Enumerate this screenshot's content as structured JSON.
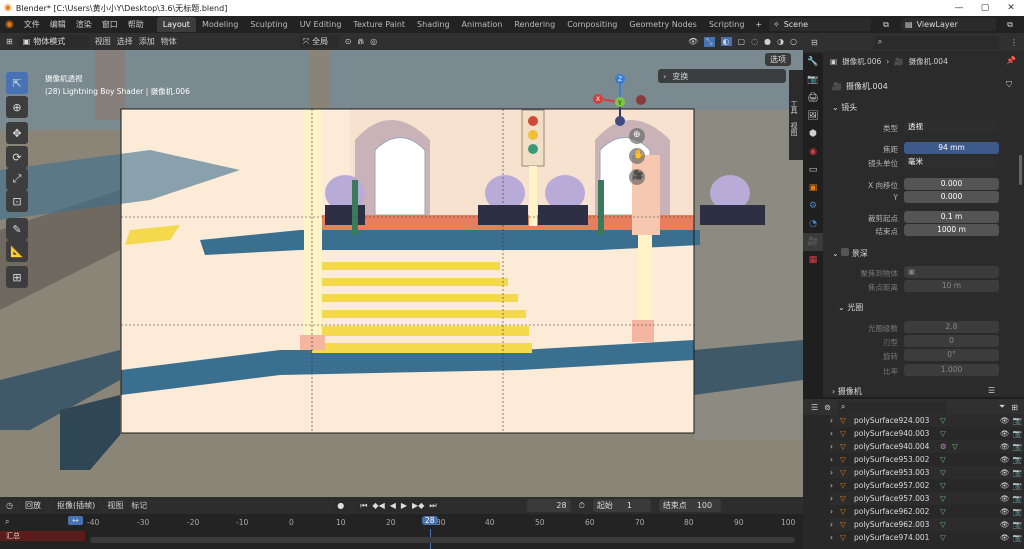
{
  "window": {
    "title": "Blender* [C:\\Users\\黄小小Y\\Desktop\\3.6\\无标题.blend]",
    "min": "—",
    "max": "▢",
    "close": "✕"
  },
  "menu": {
    "items": [
      "文件",
      "编辑",
      "渲染",
      "窗口",
      "帮助"
    ],
    "workspaces": [
      "Layout",
      "Modeling",
      "Sculpting",
      "UV Editing",
      "Texture Paint",
      "Shading",
      "Animation",
      "Rendering",
      "Compositing",
      "Geometry Nodes",
      "Scripting"
    ],
    "add_workspace": "+",
    "scene": "Scene",
    "view_layer": "ViewLayer"
  },
  "viewport_header": {
    "mode": "物体模式",
    "menus": [
      "视图",
      "选择",
      "添加",
      "物体"
    ],
    "transform_orientation": "全局",
    "options": "选项"
  },
  "viewport": {
    "camera_label": "摄像机透视",
    "object_label": "(28) Lightning Boy Shader | 摄像机.006",
    "transform_panel": "变换",
    "side_tabs": [
      "工具",
      "视图"
    ],
    "gizmo_axes": [
      "X",
      "Y",
      "Z"
    ]
  },
  "properties": {
    "breadcrumb_object": "摄像机.006",
    "breadcrumb_data": "摄像机.004",
    "data_name": "摄像机.004",
    "lens_section": "镜头",
    "type_label": "类型",
    "type_value": "透视",
    "focal_label": "焦距",
    "focal_value": "94 mm",
    "lens_unit_label": "镜头单位",
    "lens_unit_value": "毫米",
    "shift_x_label": "X 向移位",
    "shift_x_value": "0.000",
    "shift_y_label": "Y",
    "shift_y_value": "0.000",
    "clip_start_label": "裁剪起点",
    "clip_start_value": "0.1 m",
    "clip_end_label": "结束点",
    "clip_end_value": "1000 m",
    "dof_section": "景深",
    "focus_object_label": "聚焦到物体",
    "focus_distance_label": "焦点距离",
    "focus_distance_value": "10 m",
    "aperture_section": "光圈",
    "fstop_label": "光圈级数",
    "fstop_value": "2.8",
    "blades_label": "刃型",
    "blades_value": "0",
    "rotation_label": "旋转",
    "rotation_value": "0°",
    "ratio_label": "比率",
    "ratio_value": "1.000",
    "camera_section": "摄像机"
  },
  "outliner": {
    "rows": [
      "polySurface924.003",
      "polySurface940.003",
      "polySurface940.004",
      "polySurface953.002",
      "polySurface953.003",
      "polySurface957.002",
      "polySurface957.003",
      "polySurface962.002",
      "polySurface962.003",
      "polySurface974.001"
    ]
  },
  "timeline": {
    "playback": "回放",
    "keying": "抠像(插帧)",
    "view": "视图",
    "marker": "标记",
    "current_frame": "28",
    "start_label": "起始",
    "start_value": "1",
    "end_label": "结束点",
    "end_value": "100",
    "ticks": [
      "-40",
      "-30",
      "-20",
      "-10",
      "0",
      "10",
      "20",
      "30",
      "40",
      "50",
      "60",
      "70",
      "80",
      "90",
      "100"
    ],
    "playhead": "28",
    "summary": "汇总"
  }
}
